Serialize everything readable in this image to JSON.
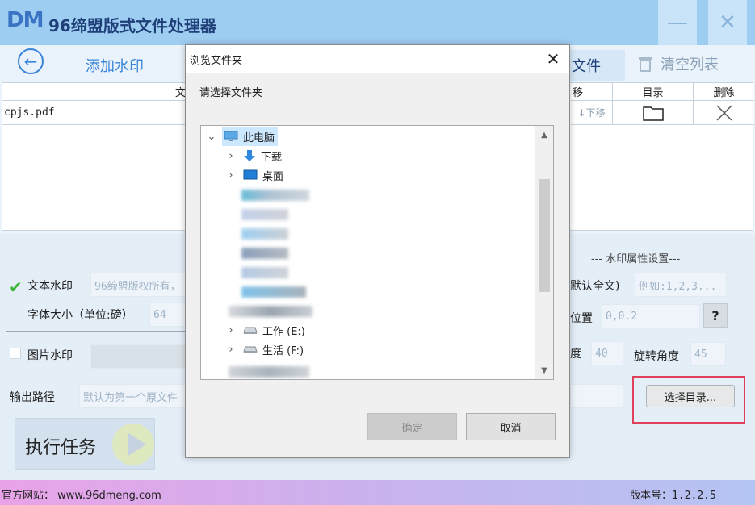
{
  "app": {
    "logo": "DM",
    "title": "96缔盟版式文件处理器",
    "minimize_glyph": "—",
    "close_glyph": "✕"
  },
  "toolbar": {
    "back_glyph": "←",
    "add_watermark": "添加水印",
    "file_tail": "文件",
    "clear_list": "清空列表"
  },
  "table": {
    "headers": {
      "file_tail": "文",
      "move_tail": "移",
      "dir": "目录",
      "delete": "删除"
    },
    "rows": [
      {
        "filename": "cpjs.pdf",
        "move_down": "↓下移"
      }
    ]
  },
  "settings": {
    "section_title": "--- 水印属性设置---",
    "text_watermark": {
      "label": "文本水印",
      "placeholder": "96缔盟版权所有，",
      "checked": true
    },
    "font_size": {
      "label": "字体大小（单位:磅）",
      "value": "64"
    },
    "pages": {
      "label_tail": "默认全文)",
      "placeholder": "例如:1,2,3..."
    },
    "position": {
      "label_tail": "位置",
      "value": "0,0.2"
    },
    "help_glyph": "?",
    "image_watermark": {
      "label": "图片水印",
      "checked": false
    },
    "opacity": {
      "label_tail": "度",
      "value": "40"
    },
    "rotation": {
      "label": "旋转角度",
      "value": "45"
    },
    "output_path": {
      "label": "输出路径",
      "placeholder": "默认为第一个原文件"
    },
    "choose_dir": "选择目录...",
    "run_task": "执行任务"
  },
  "status": {
    "site": "官方网站：  www.96dmeng.com",
    "version": "版本号：1.2.2.5"
  },
  "dialog": {
    "title": "浏览文件夹",
    "close_glyph": "✕",
    "prompt": "请选择文件夹",
    "tree": [
      {
        "label": "此电脑",
        "chevron": "⌄",
        "icon": "computer-icon",
        "selected": true
      },
      {
        "label": "下载",
        "chevron": "›",
        "icon": "download-icon"
      },
      {
        "label": "桌面",
        "chevron": "›",
        "icon": "desktop-icon"
      },
      {
        "label": "工作 (E:)",
        "chevron": "›",
        "icon": "drive-icon"
      },
      {
        "label": "生活 (F:)",
        "chevron": "›",
        "icon": "drive-icon"
      }
    ],
    "ok": "确定",
    "cancel": "取消"
  },
  "colors": {
    "titlebar": "#9ecdf2",
    "accent": "#3a85d8",
    "highlight_frame": "#e0405a",
    "check_green": "#3cb43c"
  }
}
